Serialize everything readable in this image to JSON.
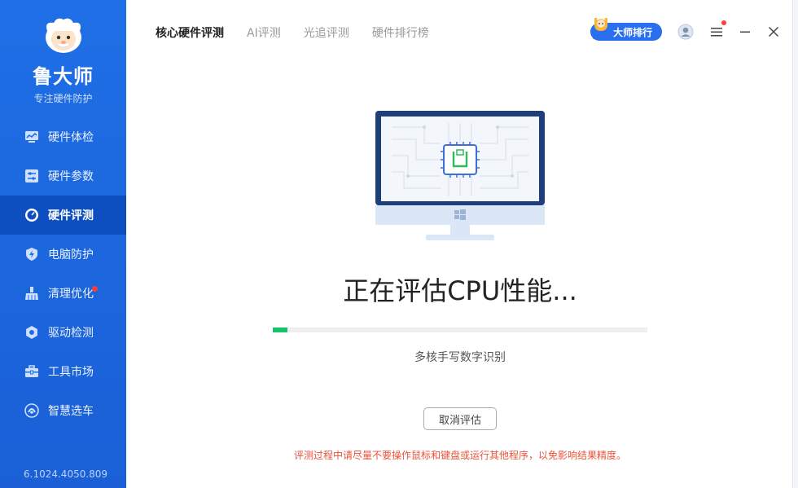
{
  "sidebar": {
    "brand": "鲁大师",
    "slogan": "专注硬件防护",
    "items": [
      {
        "label": "硬件体检",
        "icon": "chart-monitor-icon"
      },
      {
        "label": "硬件参数",
        "icon": "sliders-icon"
      },
      {
        "label": "硬件评测",
        "icon": "speedometer-icon",
        "active": true
      },
      {
        "label": "电脑防护",
        "icon": "shield-icon"
      },
      {
        "label": "清理优化",
        "icon": "broom-icon",
        "badge": true
      },
      {
        "label": "驱动检测",
        "icon": "gear-icon"
      },
      {
        "label": "工具市场",
        "icon": "toolbox-icon"
      },
      {
        "label": "智慧选车",
        "icon": "car-icon"
      }
    ],
    "version": "6.1024.4050.809"
  },
  "topbar": {
    "tabs": [
      "核心硬件评测",
      "AI评测",
      "光追评测",
      "硬件排行榜"
    ],
    "active_tab": "核心硬件评测",
    "rank_label": "大师排行"
  },
  "main": {
    "status_title": "正在评估CPU性能...",
    "progress": 0.04,
    "subtask": "多核手写数字识别",
    "cancel_label": "取消评估",
    "warning": "评测过程中请尽量不要操作鼠标和键盘或运行其他程序，以免影响结果精度。"
  },
  "colors": {
    "sidebar_bg": "#1f6fe6",
    "sidebar_active": "#0d4fc0",
    "progress_fill": "#14c46a",
    "warning": "#e8533a"
  }
}
